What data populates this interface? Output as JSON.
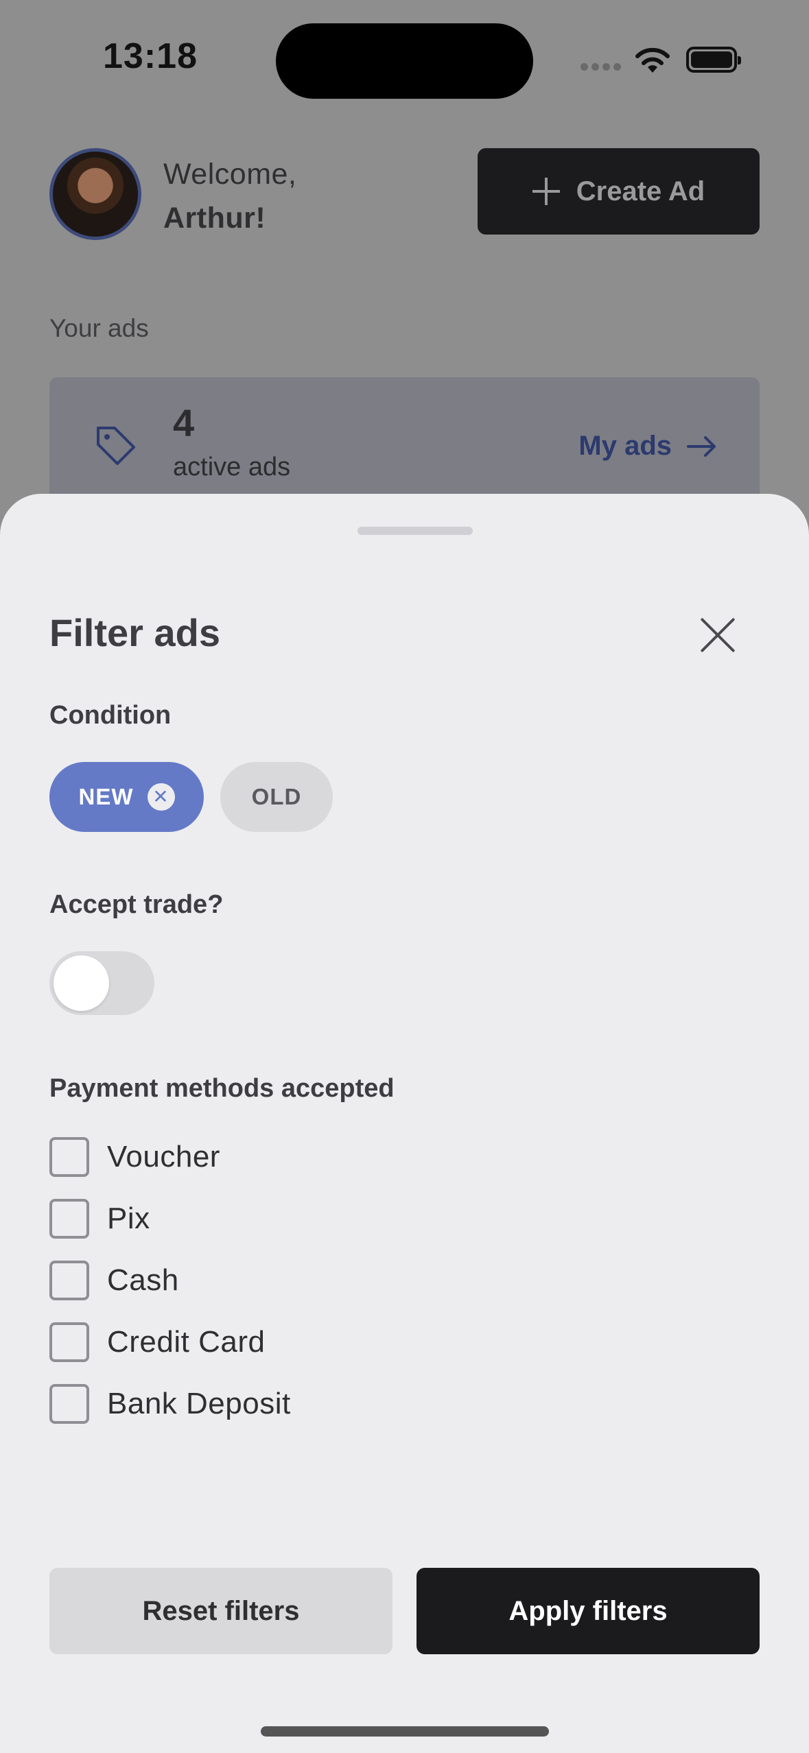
{
  "status_bar": {
    "time": "13:18"
  },
  "header": {
    "greeting": "Welcome,",
    "user_name": "Arthur!",
    "create_ad_label": "Create Ad"
  },
  "ads_summary": {
    "section_label": "Your ads",
    "count": "4",
    "count_label": "active ads",
    "link_label": "My ads"
  },
  "filter_sheet": {
    "title": "Filter ads",
    "condition": {
      "label": "Condition",
      "options": [
        {
          "label": "NEW",
          "selected": true
        },
        {
          "label": "OLD",
          "selected": false
        }
      ]
    },
    "accept_trade": {
      "label": "Accept trade?",
      "enabled": false
    },
    "payment_methods": {
      "label": "Payment methods accepted",
      "options": [
        {
          "label": "Voucher",
          "checked": false
        },
        {
          "label": "Pix",
          "checked": false
        },
        {
          "label": "Cash",
          "checked": false
        },
        {
          "label": "Credit Card",
          "checked": false
        },
        {
          "label": "Bank Deposit",
          "checked": false
        }
      ]
    },
    "reset_label": "Reset filters",
    "apply_label": "Apply filters"
  },
  "colors": {
    "accent": "#647ac7",
    "dark_button": "#1b1b1d",
    "sheet_background": "#ededf0",
    "overlay": "#8e8e8f"
  },
  "icons": [
    "wifi-icon",
    "battery-icon",
    "plus-icon",
    "tag-icon",
    "arrow-right-icon",
    "close-icon"
  ]
}
